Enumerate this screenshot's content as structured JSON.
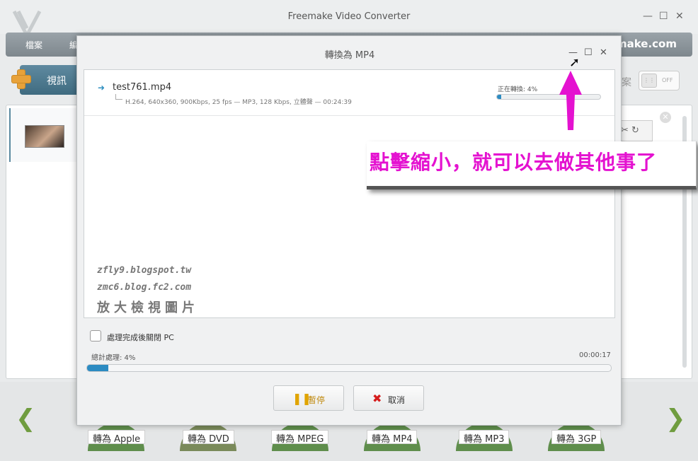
{
  "app": {
    "title": "Freemake Video Converter",
    "brand": "make.com",
    "minimize": "—",
    "maximize": "☐",
    "close": "✕"
  },
  "menu": {
    "items": [
      "檔案",
      "編"
    ]
  },
  "toolbar": {
    "video_label": "視訊",
    "right_text": "案",
    "toggle_state": "OFF"
  },
  "file_panel": {
    "close_glyph": "✕",
    "tools_glyph": "✂ ↻"
  },
  "format_buttons": [
    "轉為 Apple",
    "轉為 DVD",
    "轉為 MPEG",
    "轉為 MP4",
    "轉為 MP3",
    "轉為 3GP"
  ],
  "nav": {
    "prev": "❮",
    "next": "❯"
  },
  "dialog": {
    "title": "轉換為 MP4",
    "minimize": "—",
    "maximize": "☐",
    "close": "✕",
    "item": {
      "name": "test761.mp4",
      "details": "H.264, 640x360, 900Kbps, 25 fps — MP3, 128 Kbps, 立體聲 — 00:24:39",
      "status": "正在轉換: 4%",
      "progress": 0.04
    },
    "watermark": {
      "line1": "zfly9.blogspot.tw",
      "line2": "zmc6.blog.fc2.com",
      "line3": "放大檢視圖片"
    },
    "shutdown_label": "處理完成後關閉 PC",
    "total_label": "總計處理: 4%",
    "total_time": "00:00:17",
    "total_progress": 0.04,
    "pause_label": "暫停",
    "cancel_label": "取消"
  },
  "annotation": {
    "text": "點擊縮小，就可以去做其他事了",
    "color": "#e412d0"
  }
}
